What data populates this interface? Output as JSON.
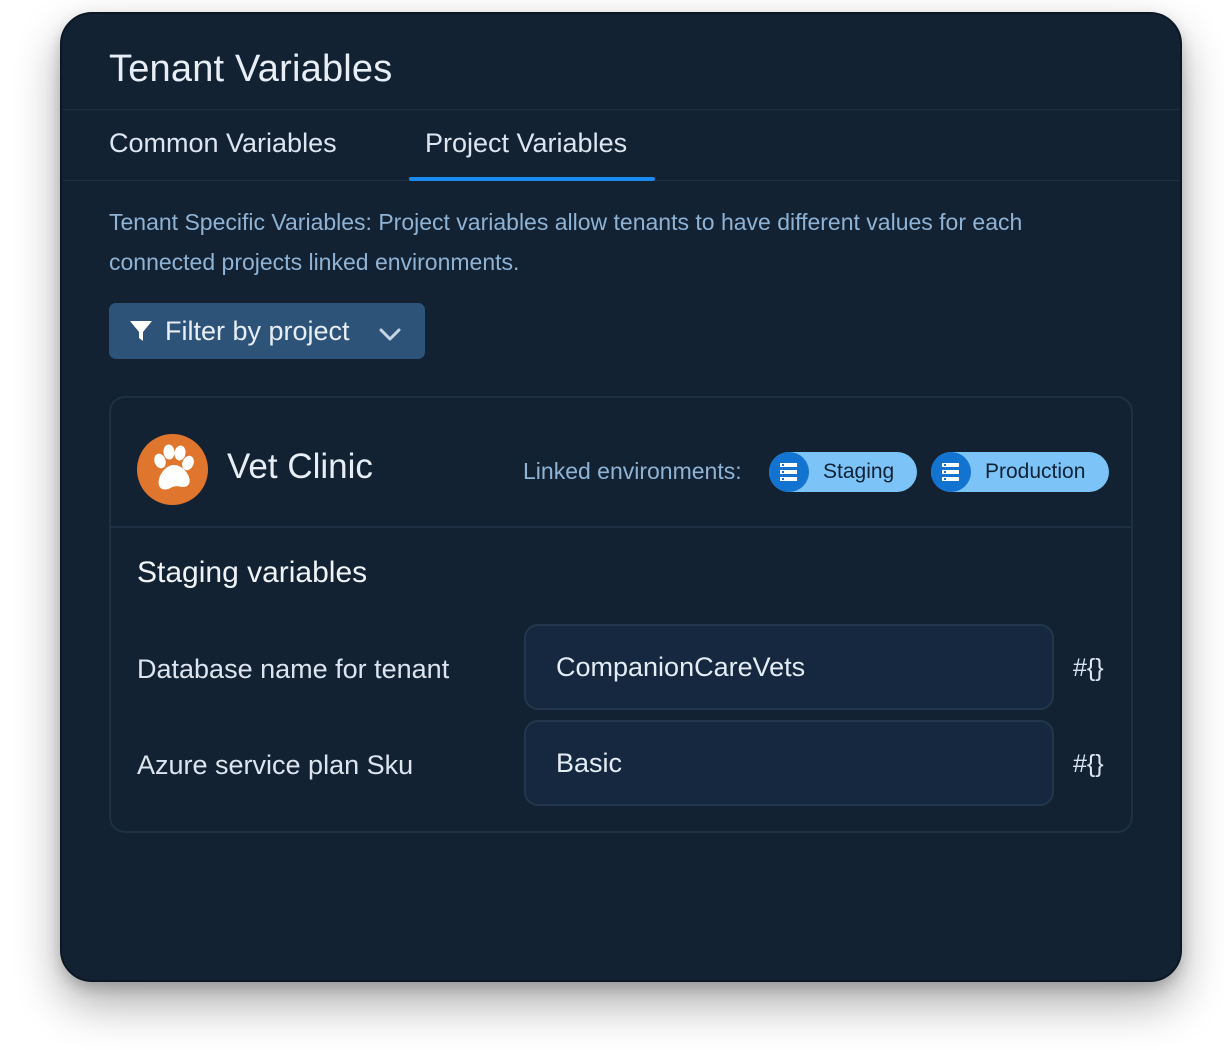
{
  "page": {
    "title": "Tenant Variables"
  },
  "tabs": [
    {
      "label": "Common Variables",
      "active": false
    },
    {
      "label": "Project Variables",
      "active": true
    }
  ],
  "description": "Tenant Specific Variables: Project variables allow tenants to have different values for each connected projects linked environments.",
  "filter": {
    "label": "Filter by project",
    "icon": "filter-icon"
  },
  "project": {
    "name": "Vet Clinic",
    "avatar_icon": "paw-icon",
    "avatar_color": "#e0762d",
    "linked_label": "Linked environments:",
    "environments": [
      {
        "name": "Staging",
        "icon": "environment-icon"
      },
      {
        "name": "Production",
        "icon": "environment-icon"
      }
    ]
  },
  "section": {
    "title": "Staging variables",
    "variables": [
      {
        "label": "Database name for tenant",
        "value": "CompanionCareVets",
        "action": "#{}"
      },
      {
        "label": "Azure service plan Sku",
        "value": "Basic",
        "action": "#{}"
      }
    ]
  },
  "colors": {
    "background": "#132233",
    "accent": "#1a8bf0",
    "chip": "#7cc3f7",
    "filter_button": "#2e5379"
  }
}
